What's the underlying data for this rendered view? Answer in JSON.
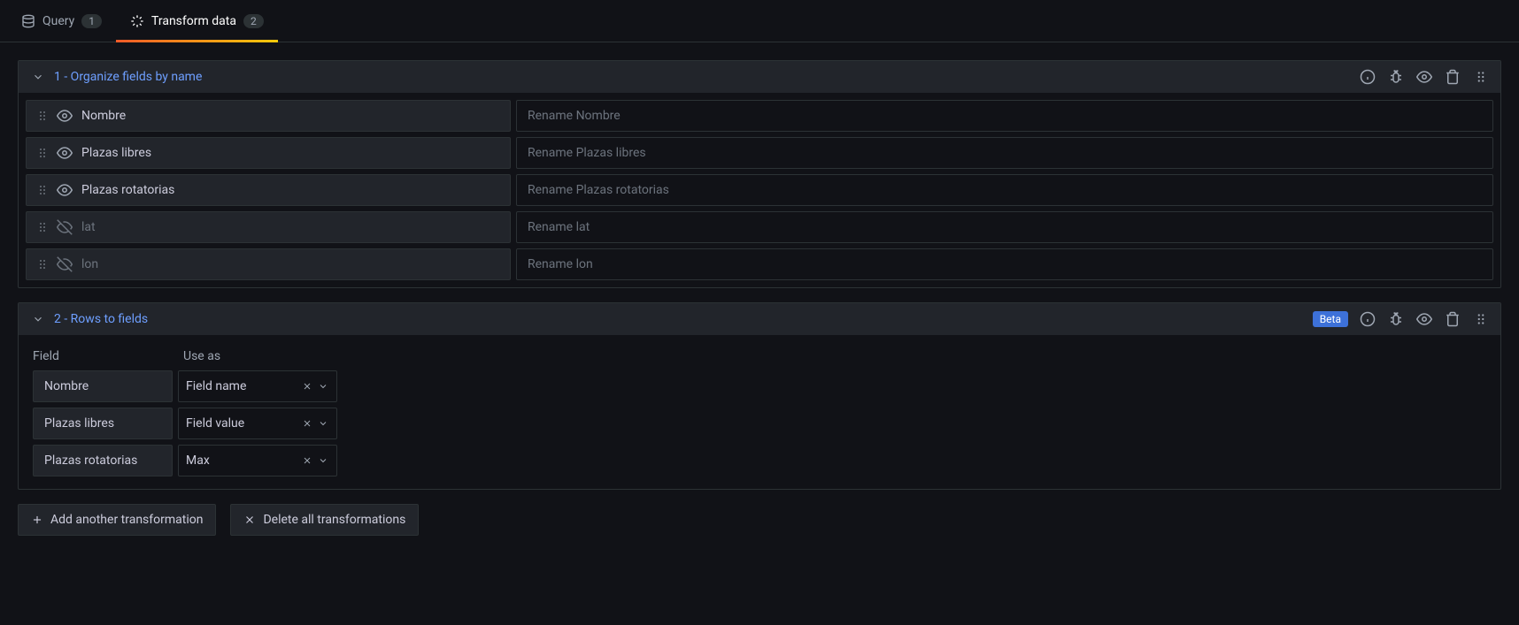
{
  "tabs": {
    "query": {
      "label": "Query",
      "badge": "1"
    },
    "transform": {
      "label": "Transform data",
      "badge": "2"
    }
  },
  "transforms": [
    {
      "title": "1 - Organize fields by name",
      "fields": [
        {
          "name": "Nombre",
          "visible": true,
          "rename_placeholder": "Rename Nombre"
        },
        {
          "name": "Plazas libres",
          "visible": true,
          "rename_placeholder": "Rename Plazas libres"
        },
        {
          "name": "Plazas rotatorias",
          "visible": true,
          "rename_placeholder": "Rename Plazas rotatorias"
        },
        {
          "name": "lat",
          "visible": false,
          "rename_placeholder": "Rename lat"
        },
        {
          "name": "lon",
          "visible": false,
          "rename_placeholder": "Rename lon"
        }
      ]
    },
    {
      "title": "2 - Rows to fields",
      "beta_label": "Beta",
      "headers": {
        "field": "Field",
        "use_as": "Use as"
      },
      "mappings": [
        {
          "field": "Nombre",
          "use_as": "Field name"
        },
        {
          "field": "Plazas libres",
          "use_as": "Field value"
        },
        {
          "field": "Plazas rotatorias",
          "use_as": "Max"
        }
      ]
    }
  ],
  "buttons": {
    "add": "Add another transformation",
    "delete_all": "Delete all transformations"
  }
}
